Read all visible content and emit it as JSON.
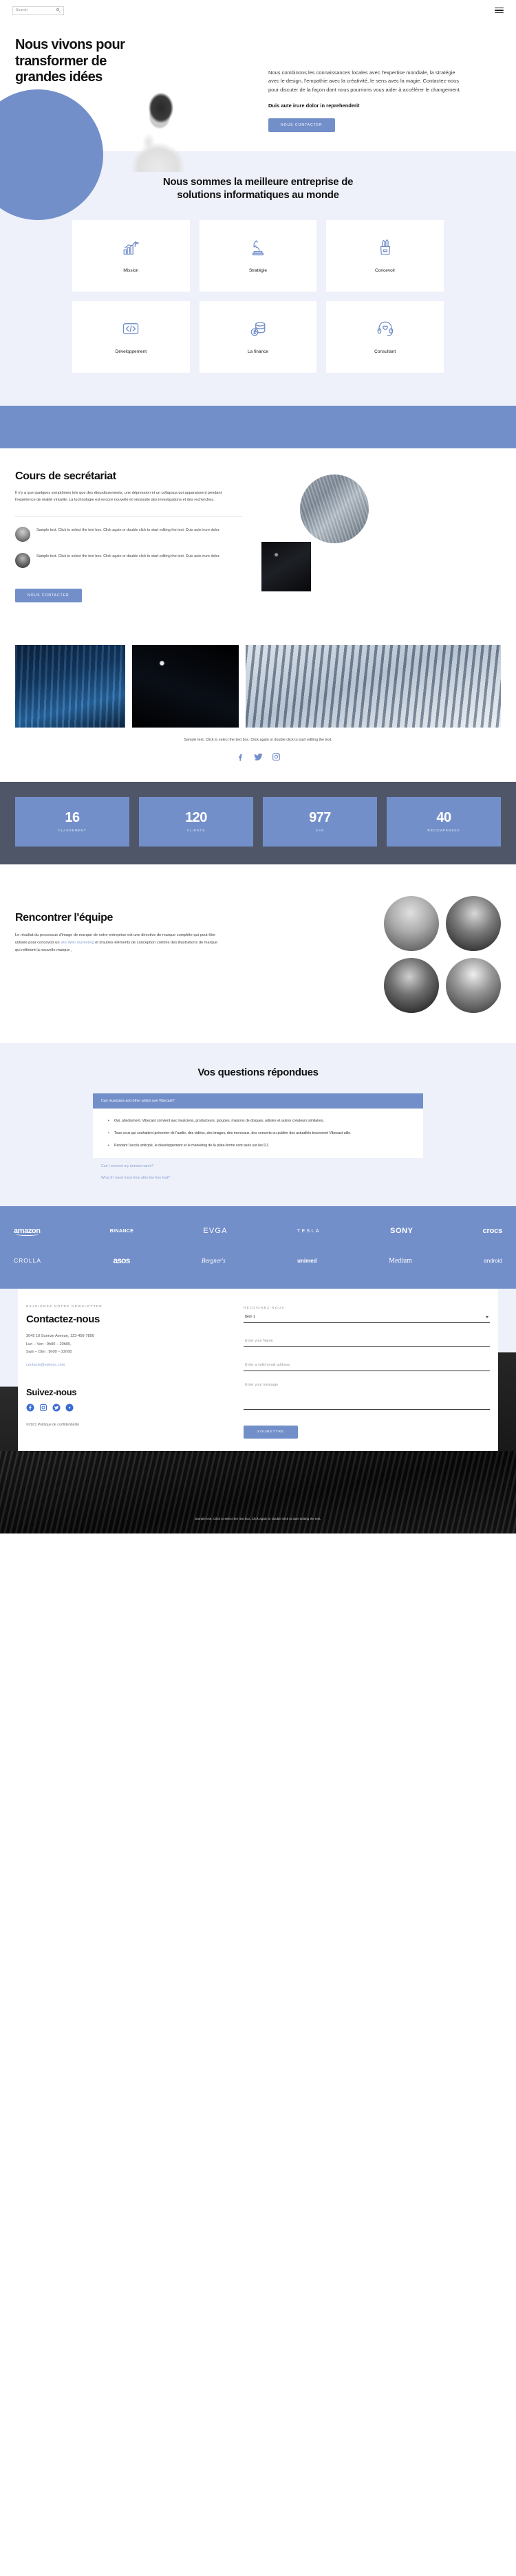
{
  "header": {
    "search_placeholder": "Search",
    "search_icon": "search-icon",
    "menu_icon": "hamburger-menu-icon"
  },
  "hero": {
    "title": "Nous vivons pour transformer de grandes idées",
    "paragraph": "Nous combinons les connaissances locales avec l'expertise mondiale, la stratégie avec le design, l'empathie avec la créativité, le sens avec la magie. Contactez-nous pour discuter de la façon dont nous pourrions vous aider à accélérer le changement.",
    "bold_line": "Duis aute irure dolor in reprehenderit",
    "cta": "NOUS CONTACTER"
  },
  "services": {
    "title": "Nous sommes la meilleure entreprise de solutions informatiques au monde",
    "cards": [
      {
        "label": "Mission",
        "icon": "growth-chart-flag-icon"
      },
      {
        "label": "Stratégie",
        "icon": "chess-knight-icon"
      },
      {
        "label": "Concevoir",
        "icon": "pencil-cup-icon"
      },
      {
        "label": "Développement",
        "icon": "code-brackets-icon"
      },
      {
        "label": "La finance",
        "icon": "coins-stack-icon"
      },
      {
        "label": "Consultant",
        "icon": "headset-support-icon"
      }
    ]
  },
  "course": {
    "title": "Cours de secrétariat",
    "paragraph": "Il n'y a que quelques symptômes tels que des étourdissements, une dépression et un collapsus qui apparaissent pendant l'expérience de réalité virtuelle. La technologie est encore nouvelle et nécessite des investigations et des recherches.",
    "quotes": [
      "Sample text. Click to select the text box. Click again or double click to start editing the text. Duis aute irure dolor.",
      "Sample text. Click to select the text box. Click again or double click to start editing the text. Duis aute irure dolor."
    ],
    "cta": "NOUS CONTACTER"
  },
  "gallery": {
    "caption": "Sample text. Click to select the text box. Click again or double click to start editing the text.",
    "socials": [
      "facebook-icon",
      "twitter-icon",
      "instagram-icon"
    ]
  },
  "stats": [
    {
      "value": "16",
      "label": "CLASSEMENT"
    },
    {
      "value": "120",
      "label": "CLIENTS"
    },
    {
      "value": "977",
      "label": "CAS"
    },
    {
      "value": "40",
      "label": "RÉCOMPENSES"
    }
  ],
  "team": {
    "title": "Rencontrer l'équipe",
    "paragraph_before": "Le résultat du processus d'image de marque de notre entreprise est une directive de marque complète qui peut être utilisée pour concevoir un ",
    "link": "site Web marketing",
    "paragraph_after": " et d'autres éléments de conception comme des illustrations de marque qui reflètent la nouvelle marque ,"
  },
  "faq": {
    "title": "Vos questions répondues",
    "open_question": "Can musicians and other artists use Vibecast?",
    "answers": [
      "Oui, absolument. Vibecast convient aux musiciens, producteurs, groupes, maisons de disques, artistes et autres créateurs similaires.",
      "Tous ceux qui souhaitent présenter de l'audio, des vidéos, des images, des morceaux, des concerts ou publier des actualités trouveront Vibecast utile.",
      "Pendant l'accès anticipé, le développement et le marketing de la plate-forme sont axés sur les DJ."
    ],
    "closed_questions": [
      "Can I connect my domain name?",
      "What if I need more time after the free trial?"
    ]
  },
  "brands": {
    "row1": [
      "amazon",
      "BINANCE",
      "EVGA",
      "TESLA",
      "SONY",
      "crocs"
    ],
    "row2": [
      "CROLLA",
      "asos",
      "Bergner's",
      "unimed",
      "Medium",
      "android"
    ]
  },
  "contact": {
    "eyebrow": "REJOIGNEZ NOTRE NEWSLETTER",
    "title": "Contactez-nous",
    "address": "3045 10 Sunrize Avenue, 123-456-7890",
    "hours_1": "Lun – Ven : 9h00 – 20h00,",
    "hours_2": "Sam – Dim : 9h00 – 22h00",
    "email": "contacts@esbnyc.com",
    "follow_title": "Suivez-nous",
    "social_icons": [
      "facebook-icon",
      "instagram-icon",
      "twitter-icon",
      "youtube-icon"
    ],
    "copyright": "©2021 Politique de confidentialité"
  },
  "form": {
    "eyebrow": "REJOIGNEZ-NOUS",
    "select_value": "Item 1",
    "name_placeholder": "Enter your Name",
    "email_placeholder": "Enter a valid email address",
    "message_placeholder": "Enter your message",
    "submit": "SOUMETTRE"
  },
  "footer": {
    "note": "Sample text. Click to select the text box. Click again or double click to start editing the text."
  },
  "colors": {
    "accent": "#738fca",
    "light_bg": "#eef1fa",
    "dark_bg": "#4e5668",
    "link": "#8ba2d6"
  }
}
